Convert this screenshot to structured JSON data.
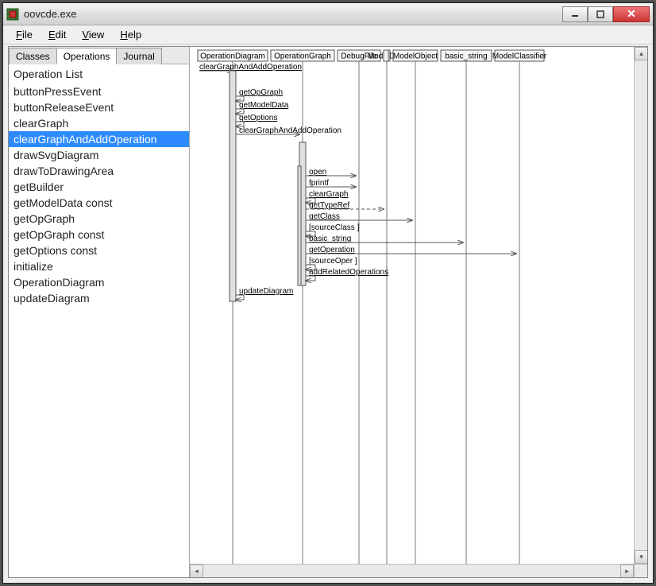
{
  "window": {
    "title": "oovcde.exe"
  },
  "menu": {
    "file": "File",
    "edit": "Edit",
    "view": "View",
    "help": "Help"
  },
  "tabs": {
    "classes": "Classes",
    "operations": "Operations",
    "journal": "Journal",
    "active": "operations"
  },
  "oplist": {
    "header": "Operation List",
    "items": [
      "buttonPressEvent",
      "buttonReleaseEvent",
      "clearGraph",
      "clearGraphAndAddOperation",
      "drawSvgDiagram",
      "drawToDrawingArea",
      "getBuilder",
      "getModelData const",
      "getOpGraph",
      "getOpGraph const",
      "getOptions const",
      "initialize",
      "OperationDiagram",
      "updateDiagram"
    ],
    "selected": 3
  },
  "sequence": {
    "participants": [
      "OperationDiagram",
      "OperationGraph",
      "DebugFile",
      "ModelData",
      "ModelObject",
      "basic_string",
      "ModelClassifier"
    ],
    "initial": "clearGraphAndAddOperation",
    "calls1": [
      "getOpGraph",
      "getModelData",
      "getOptions",
      "clearGraphAndAddOperation"
    ],
    "calls2": [
      {
        "label": "open",
        "u": true,
        "to": 2
      },
      {
        "label": "fprintf",
        "u": false,
        "to": 2
      },
      {
        "label": "clearGraph",
        "u": true,
        "to": 1
      },
      {
        "label": "getTypeRef",
        "u": true,
        "to": 3,
        "dash": true
      },
      {
        "label": "getClass",
        "u": true,
        "to": 4
      },
      {
        "label": "[sourceClass ]",
        "u": false,
        "to": 1
      },
      {
        "label": "basic_string",
        "u": true,
        "to": 5
      },
      {
        "label": "getOperation",
        "u": true,
        "to": 6
      },
      {
        "label": "[sourceOper ]",
        "u": false,
        "to": 1
      },
      {
        "label": "addRelatedOperations",
        "u": true,
        "to": 1
      }
    ],
    "last": "updateDiagram"
  }
}
